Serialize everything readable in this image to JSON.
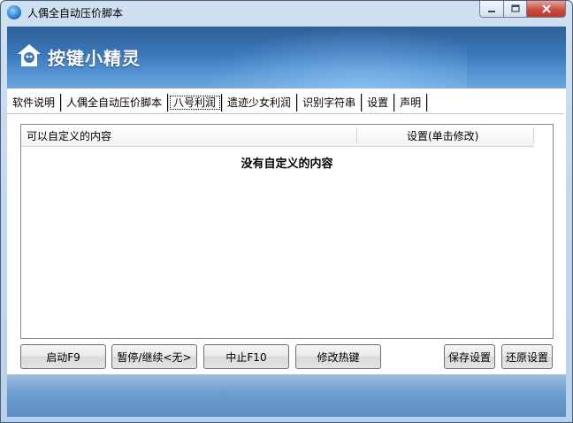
{
  "window": {
    "title": "人偶全自动压价脚本"
  },
  "banner": {
    "logo_text": "按键小精灵"
  },
  "tabs": [
    {
      "label": "软件说明"
    },
    {
      "label": "人偶全自动压价脚本"
    },
    {
      "label": "八号利润"
    },
    {
      "label": "遗迹少女利润"
    },
    {
      "label": "识别字符串"
    },
    {
      "label": "设置"
    },
    {
      "label": "声明"
    }
  ],
  "list": {
    "col1": "可以自定义的内容",
    "col2": "设置(单击修改)",
    "empty": "没有自定义的内容"
  },
  "buttons": {
    "start": "启动F9",
    "pause": "暂停/继续<无>",
    "stop": "中止F10",
    "hotkey": "修改热键",
    "save": "保存设置",
    "restore": "还原设置"
  }
}
